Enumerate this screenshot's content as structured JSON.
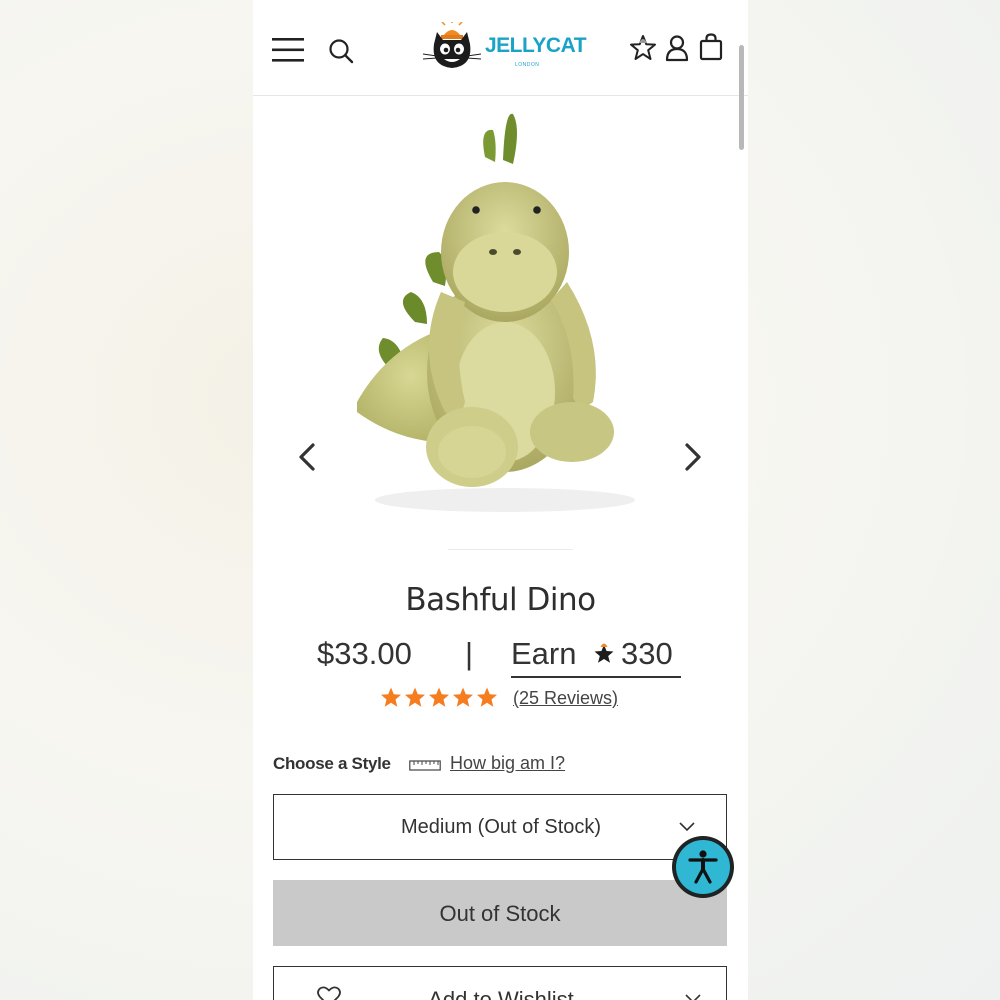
{
  "header": {
    "brand": "JELLYCAT",
    "brand_sub": "LONDON",
    "icons": [
      "menu-icon",
      "search-icon",
      "rewards-star-icon",
      "account-icon",
      "bag-icon"
    ]
  },
  "product": {
    "title": "Bashful Dino",
    "price": "$33.00",
    "separator": "|",
    "earn_label": "Earn",
    "earn_points": "330",
    "rating": 5,
    "reviews": "(25 Reviews)"
  },
  "style": {
    "label": "Choose a Style",
    "size_guide": "How big am I?",
    "selected": "Medium (Out of Stock)"
  },
  "actions": {
    "out_of_stock": "Out of Stock",
    "wishlist": "Add to Wishlist"
  },
  "colors": {
    "brand": "#1aa3c6",
    "star": "#f57c1f",
    "disabled_button": "#c9c9c9",
    "accessibility": "#2fb7d3"
  }
}
